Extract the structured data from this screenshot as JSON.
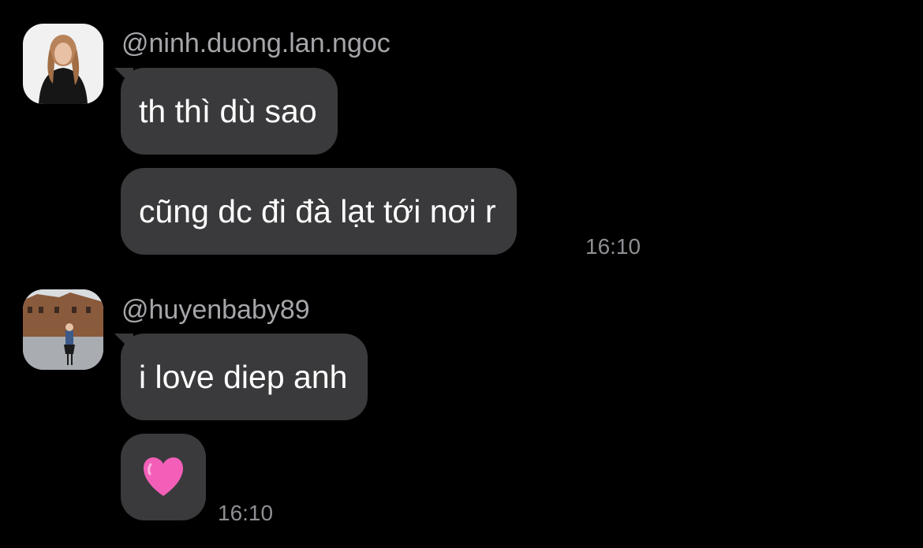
{
  "messages": [
    {
      "username": "@ninh.duong.lan.ngoc",
      "bubbles": [
        "th thì dù sao",
        "cũng dc đi đà lạt tới nơi r"
      ],
      "time": "16:10"
    },
    {
      "username": "@huyenbaby89",
      "bubbles": [
        "i love diep anh",
        "🩷"
      ],
      "time": "16:10"
    }
  ],
  "colors": {
    "background": "#000000",
    "bubble": "#3a3a3c",
    "username": "#a6a6aa",
    "timestamp": "#8e8e93",
    "heart": "#f35fb8"
  },
  "icons": {
    "heart": "pink-heart-icon"
  }
}
